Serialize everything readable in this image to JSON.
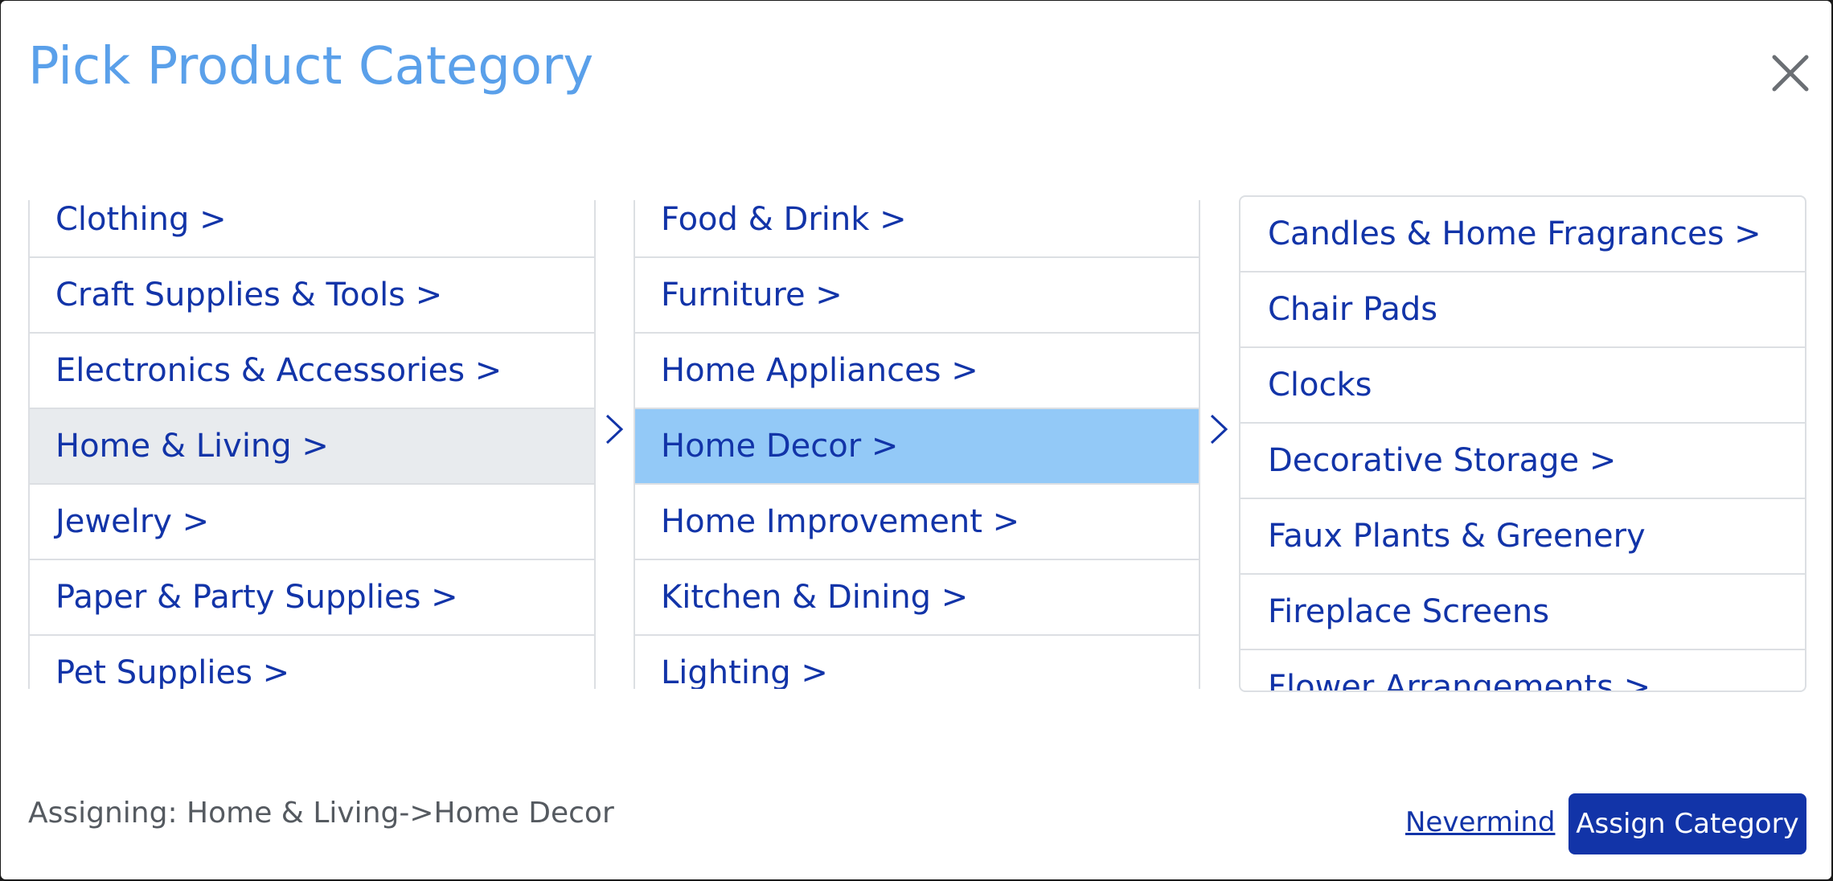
{
  "dialog": {
    "title": "Pick Product Category",
    "close_label": "close"
  },
  "columns": {
    "level1": {
      "items": [
        {
          "label": "Clothing >"
        },
        {
          "label": "Craft Supplies & Tools >"
        },
        {
          "label": "Electronics & Accessories >"
        },
        {
          "label": "Home & Living >",
          "state": "active"
        },
        {
          "label": "Jewelry >"
        },
        {
          "label": "Paper & Party Supplies >"
        },
        {
          "label": "Pet Supplies >"
        }
      ]
    },
    "level2": {
      "items": [
        {
          "label": "Food & Drink >"
        },
        {
          "label": "Furniture >"
        },
        {
          "label": "Home Appliances >"
        },
        {
          "label": "Home Decor >",
          "state": "selected"
        },
        {
          "label": "Home Improvement >"
        },
        {
          "label": "Kitchen & Dining >"
        },
        {
          "label": "Lighting >"
        }
      ]
    },
    "level3": {
      "items": [
        {
          "label": "Candles & Home Fragrances >"
        },
        {
          "label": "Chair Pads"
        },
        {
          "label": "Clocks"
        },
        {
          "label": "Decorative Storage >"
        },
        {
          "label": "Faux Plants & Greenery"
        },
        {
          "label": "Fireplace Screens"
        },
        {
          "label": "Flower Arrangements >"
        }
      ]
    }
  },
  "footer": {
    "status": "Assigning: Home & Living->Home Decor",
    "nevermind_label": "Nevermind",
    "assign_label": "Assign Category"
  },
  "colors": {
    "title": "#5aa0ea",
    "link": "#1234a8",
    "primary_button": "#1234a8",
    "selected_row": "#93c9f7",
    "active_row": "#e8ebee"
  },
  "icons": {
    "close": "close-icon",
    "column_separator": "chevron-right-icon"
  }
}
